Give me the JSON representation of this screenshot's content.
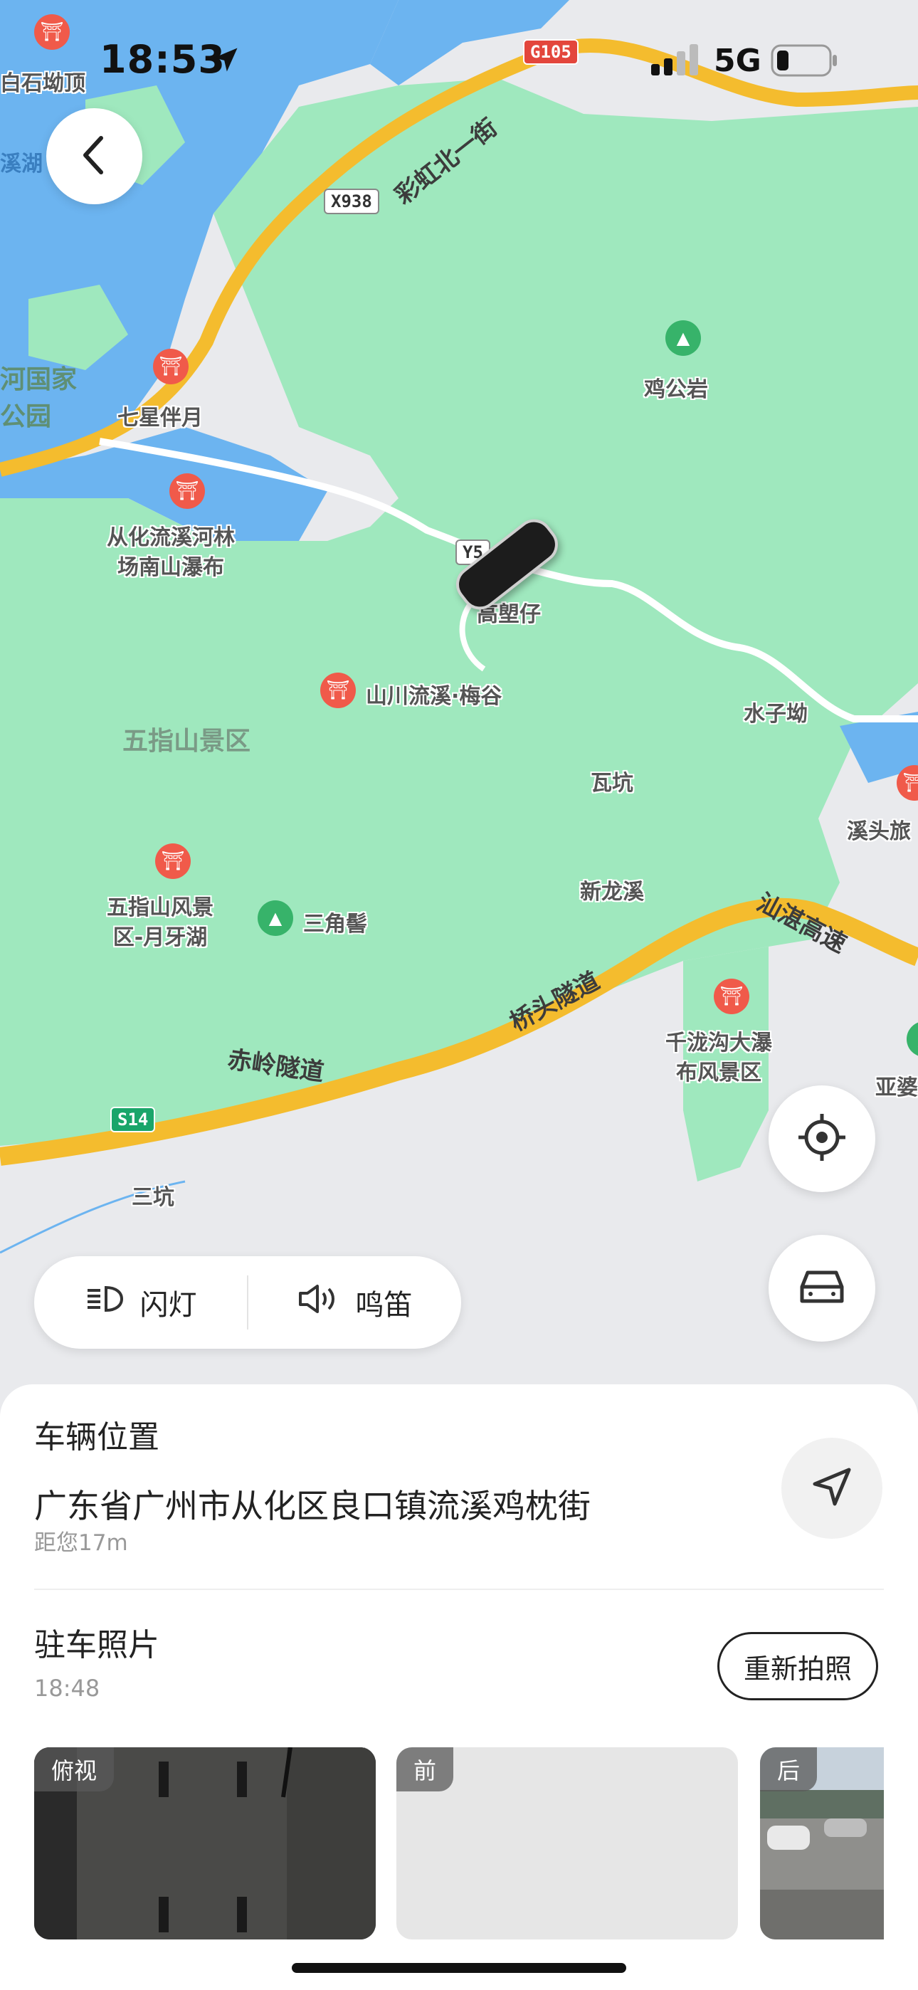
{
  "status_bar": {
    "time": "18:53",
    "network": "5G"
  },
  "map": {
    "road_shields": [
      {
        "id": "g105",
        "text": "G105",
        "kind": "national"
      },
      {
        "id": "x938",
        "text": "X938",
        "kind": "county"
      },
      {
        "id": "s14",
        "text": "S14",
        "kind": "expressway"
      },
      {
        "id": "y5",
        "text": "Y5",
        "kind": "county"
      }
    ],
    "road_labels": [
      {
        "id": "caihong",
        "text": "彩虹北一街"
      },
      {
        "id": "shantan",
        "text": "汕湛高速"
      },
      {
        "id": "qiaotou",
        "text": "桥头隧道"
      },
      {
        "id": "chiling",
        "text": "赤岭隧道"
      }
    ],
    "pois": [
      {
        "id": "baishi",
        "text": "白石坳顶",
        "icon": "scenic-icon"
      },
      {
        "id": "qixing",
        "text": "七星伴月",
        "icon": "scenic-icon"
      },
      {
        "id": "jigong",
        "text": "鸡公岩",
        "icon": "mountain-icon"
      },
      {
        "id": "nanshan",
        "text": "从化流溪河林\n场南山瀑布",
        "icon": "scenic-icon"
      },
      {
        "id": "meigu",
        "text": "山川流溪·梅谷",
        "icon": "scenic-icon"
      },
      {
        "id": "yueya",
        "text": "五指山风景\n区-月牙湖",
        "icon": "scenic-icon"
      },
      {
        "id": "sanjiao",
        "text": "三角髻",
        "icon": "mountain-icon"
      },
      {
        "id": "qianlong",
        "text": "千泷沟大瀑\n布风景区",
        "icon": "scenic-icon"
      },
      {
        "id": "xitou",
        "text": "溪头旅",
        "icon": "scenic-icon"
      },
      {
        "id": "yapo",
        "text": "亚婆",
        "icon": "mountain-icon"
      }
    ],
    "places": [
      {
        "id": "gaowangzai",
        "text": "高塱仔"
      },
      {
        "id": "shuiziao",
        "text": "水子坳"
      },
      {
        "id": "wakeng",
        "text": "瓦坑"
      },
      {
        "id": "xinlongxi",
        "text": "新龙溪"
      },
      {
        "id": "sankeng",
        "text": "三坑"
      },
      {
        "id": "xihu",
        "text": "溪湖"
      }
    ],
    "areas": [
      {
        "id": "wuzhishan",
        "text": "五指山景区"
      },
      {
        "id": "guojia",
        "text": "河国家\n公园"
      }
    ]
  },
  "controls": {
    "flash_label": "闪灯",
    "horn_label": "鸣笛",
    "flash_icon": "headlight-icon",
    "horn_icon": "speaker-icon",
    "locate_icon": "locate-icon",
    "car_icon": "car-icon",
    "back_icon": "back-chevron-icon"
  },
  "vehicle": {
    "section_title": "车辆位置",
    "address": "广东省广州市从化区良口镇流溪鸡枕街",
    "distance": "距您17m",
    "navigate_icon": "navigate-icon"
  },
  "photos": {
    "section_title": "驻车照片",
    "time": "18:48",
    "retake_label": "重新拍照",
    "items": [
      {
        "label": "俯视"
      },
      {
        "label": "前"
      },
      {
        "label": "后"
      }
    ]
  },
  "colors": {
    "water": "#6cb4f0",
    "park": "#9fe8be",
    "land": "#e9eaed",
    "highway": "#f4bc2e",
    "road": "#ffffff"
  }
}
